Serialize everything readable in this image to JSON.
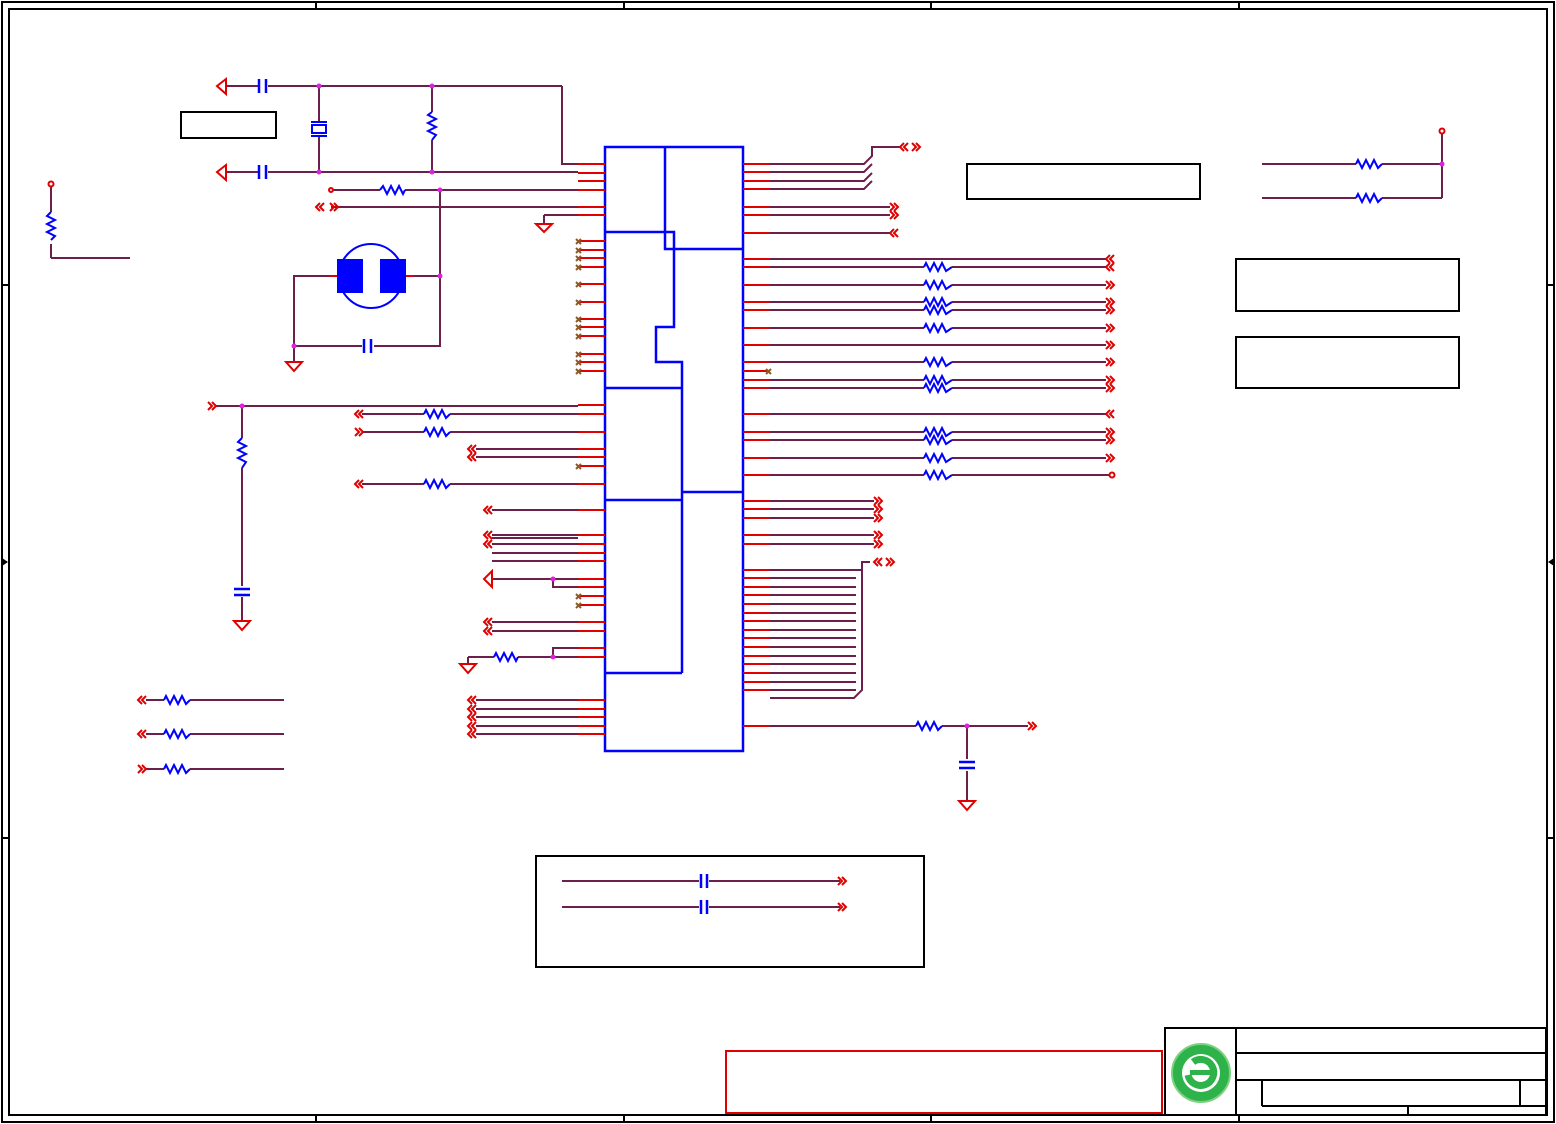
{
  "colors": {
    "background": "#ffffff",
    "frame": "#000000",
    "wire": "#6b1f4a",
    "pin": "#e00000",
    "component": "#0000ff",
    "junction": "#e020e0",
    "noconnect": "#8b5a2b",
    "power": "#e00000",
    "note_box": "#e00000",
    "logo_ring": "#2db34a",
    "logo_inner": "#7fd080"
  },
  "icons": [
    "ground-icon",
    "power-port-icon",
    "resistor-icon",
    "capacitor-icon",
    "crystal-icon",
    "offpage-connector-icon",
    "company-logo-icon"
  ]
}
